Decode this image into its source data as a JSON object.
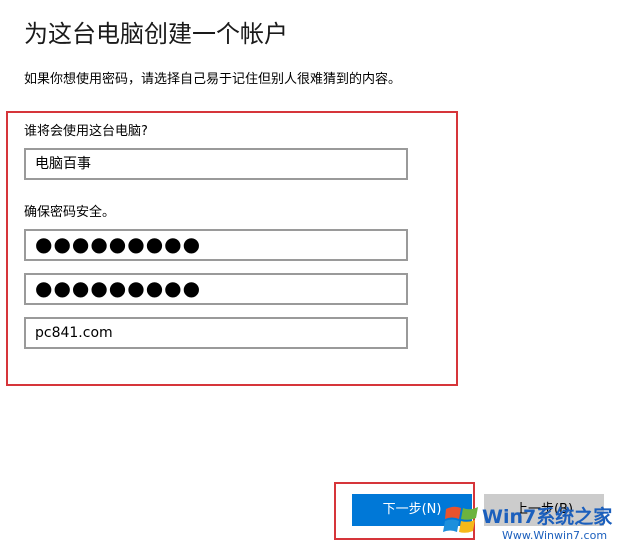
{
  "header": {
    "title": "为这台电脑创建一个帐户",
    "description": "如果你想使用密码，请选择自己易于记住但别人很难猜到的内容。"
  },
  "form": {
    "user_label": "谁将会使用这台电脑?",
    "username_value": "电脑百事",
    "password_label": "确保密码安全。",
    "password_value": "●●●●●●●●●",
    "password_confirm_value": "●●●●●●●●●",
    "hint_value": "pc841.com"
  },
  "buttons": {
    "next_label": "下一步(N)",
    "back_label": "上一步(B)"
  },
  "watermark": {
    "brand": "Win7系统之家",
    "url": "Www.Winwin7.com"
  },
  "colors": {
    "accent": "#0078d7",
    "highlight_border": "#d6353a",
    "secondary_button": "#cccccc"
  }
}
